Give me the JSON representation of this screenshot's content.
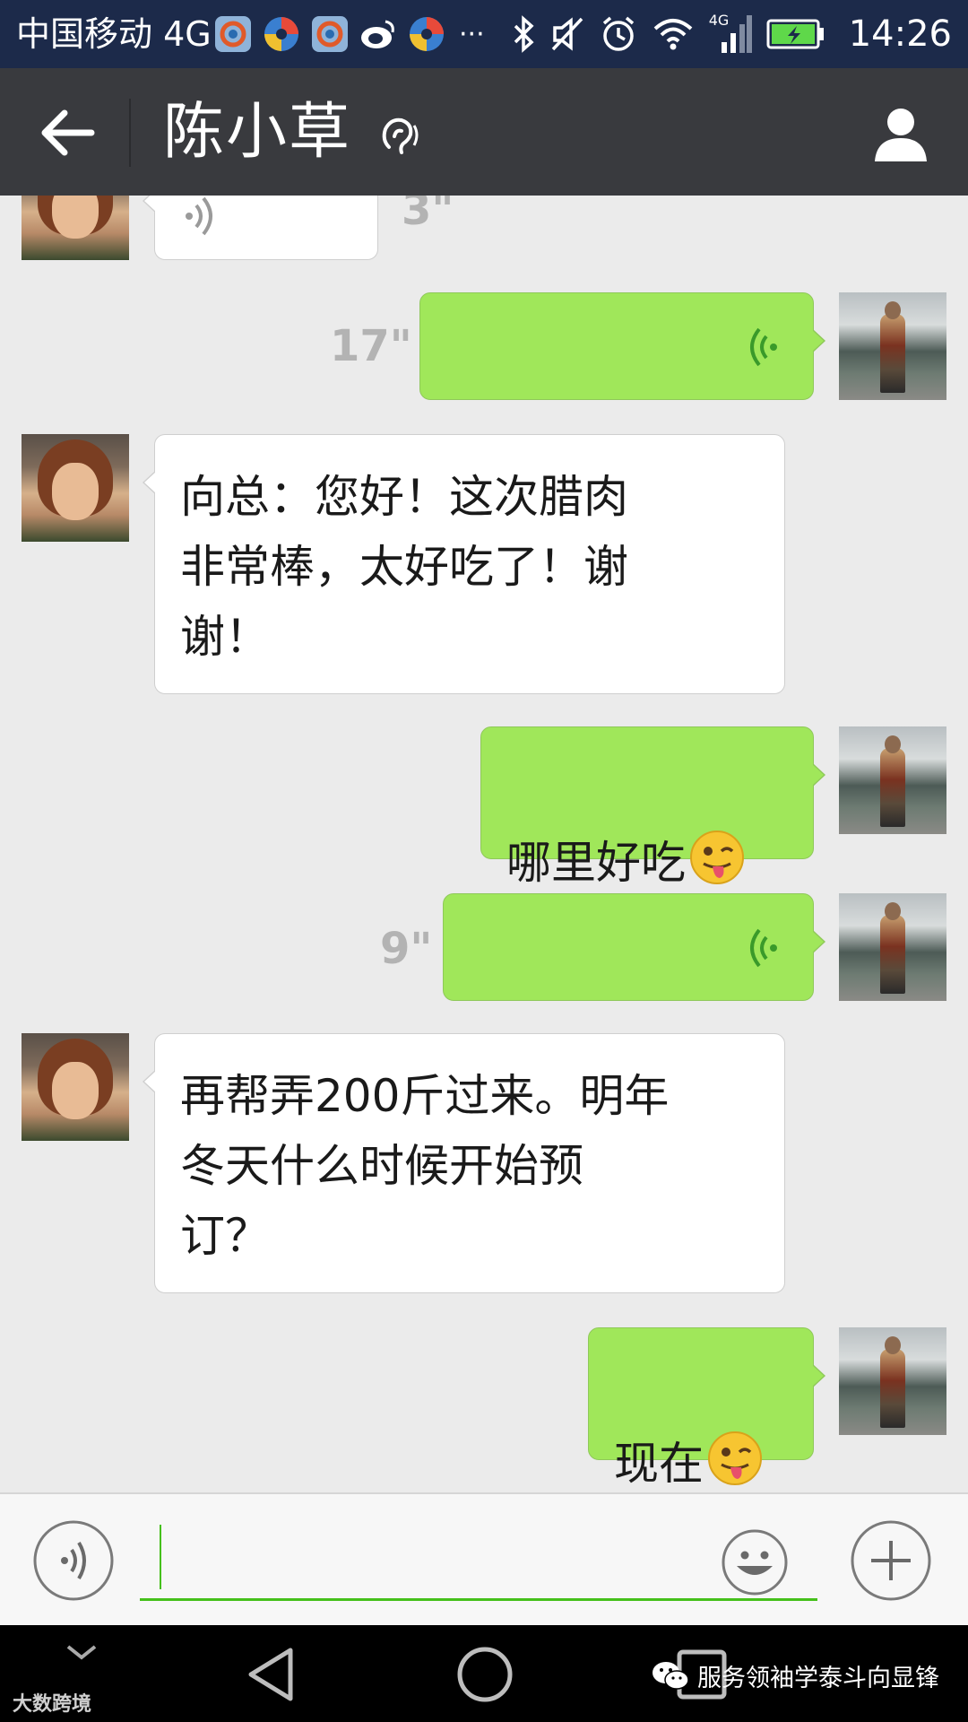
{
  "status_bar": {
    "carrier": "中国移动 4G",
    "network_badge": "4G",
    "time": "14:26",
    "icons": [
      "app-icon",
      "app-icon",
      "app-icon",
      "weibo-icon",
      "app-icon",
      "more-dots-icon",
      "bluetooth-icon",
      "mute-icon",
      "alarm-icon",
      "wifi-icon",
      "signal-icon",
      "battery-icon"
    ],
    "overflow": "···"
  },
  "header": {
    "title": "陈小草",
    "icons": [
      "back-arrow-icon",
      "earpiece-icon",
      "profile-icon"
    ]
  },
  "messages": [
    {
      "side": "in",
      "type": "voice",
      "duration": "3\""
    },
    {
      "side": "out",
      "type": "voice",
      "duration": "17\""
    },
    {
      "side": "in",
      "type": "text",
      "text": "向总：您好！这次腊肉\n非常棒，太好吃了！谢\n谢！"
    },
    {
      "side": "out",
      "type": "text",
      "text": "哪里好吃",
      "emoji": "wink-tongue-emoji"
    },
    {
      "side": "out",
      "type": "voice",
      "duration": "9\""
    },
    {
      "side": "in",
      "type": "text",
      "text": "再帮弄200斤过来。明年\n冬天什么时候开始预\n订？"
    },
    {
      "side": "out",
      "type": "text",
      "text": "现在",
      "emoji": "wink-tongue-emoji"
    }
  ],
  "input_bar": {
    "value": "",
    "icons": [
      "voice-mode-icon",
      "emoji-icon",
      "plus-icon"
    ]
  },
  "watermark": {
    "left": "大数跨境",
    "right": "服务领袖学泰斗向显锋"
  },
  "colors": {
    "status_bar": "#1c2a4a",
    "header": "#393a3e",
    "chat_bg": "#ebebeb",
    "outgoing_bubble": "#a0e75a",
    "incoming_bubble": "#ffffff",
    "accent": "#45c01a"
  }
}
